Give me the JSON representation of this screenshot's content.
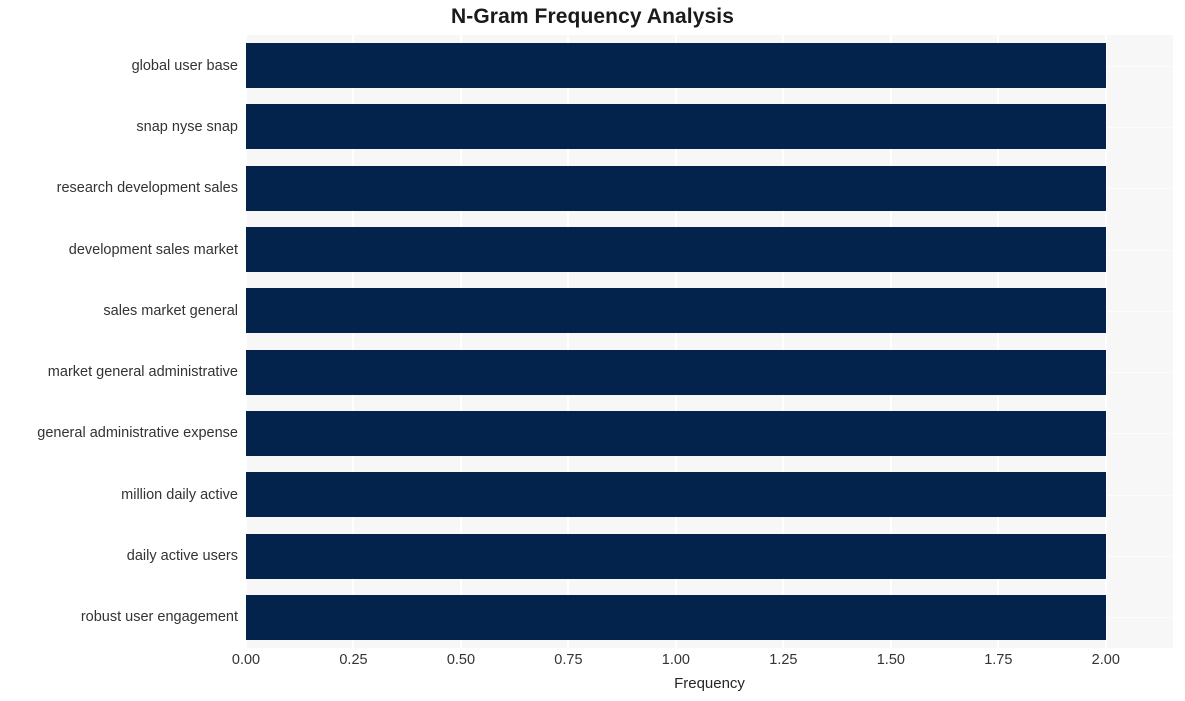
{
  "chart_data": {
    "type": "bar",
    "orientation": "horizontal",
    "title": "N-Gram Frequency Analysis",
    "xlabel": "Frequency",
    "ylabel": "",
    "categories": [
      "global user base",
      "snap nyse snap",
      "research development sales",
      "development sales market",
      "sales market general",
      "market general administrative",
      "general administrative expense",
      "million daily active",
      "daily active users",
      "robust user engagement"
    ],
    "values": [
      2,
      2,
      2,
      2,
      2,
      2,
      2,
      2,
      2,
      2
    ],
    "xlim": [
      0,
      2.1563
    ],
    "xticks": [
      0.0,
      0.25,
      0.5,
      0.75,
      1.0,
      1.25,
      1.5,
      1.75,
      2.0
    ],
    "xtick_labels": [
      "0.00",
      "0.25",
      "0.50",
      "0.75",
      "1.00",
      "1.25",
      "1.50",
      "1.75",
      "2.00"
    ],
    "grid": true,
    "grid_axis": "both",
    "legend": null,
    "bar_color": "#03234d",
    "plot_background": "#f7f7f7",
    "gridline_color": "#ffffff",
    "figure_background": "#ffffff",
    "text_color": "#333333"
  }
}
